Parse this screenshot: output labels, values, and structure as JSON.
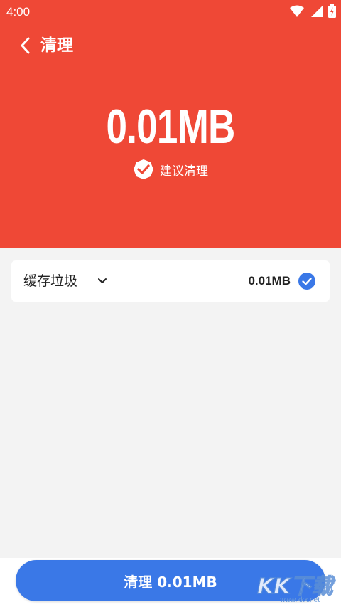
{
  "status_bar": {
    "time": "4:00"
  },
  "header": {
    "title": "清理",
    "size_value": "0.01MB",
    "suggest_text": "建议清理",
    "background": "#ef4836"
  },
  "items": [
    {
      "label": "缓存垃圾",
      "size": "0.01MB",
      "checked": true
    }
  ],
  "clean_button": {
    "label": "清理 0.01MB",
    "color": "#3a78e7"
  },
  "watermark": {
    "brand": "KK下载",
    "url": "www.kkx.net"
  }
}
